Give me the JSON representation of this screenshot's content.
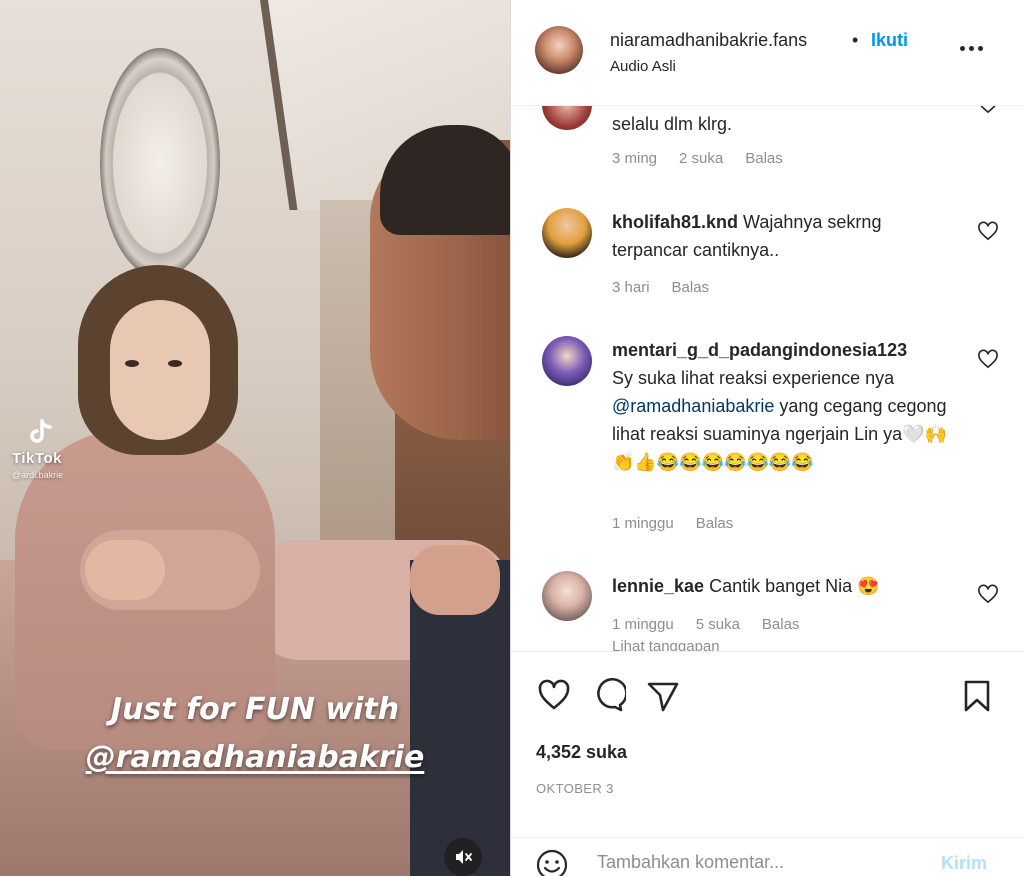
{
  "video": {
    "watermark_brand": "TikTok",
    "watermark_user": "@ardi.bakrie",
    "caption_line1": "Just for FUN with",
    "caption_line2": "@ramadhaniabakrie"
  },
  "header": {
    "username": "niaramadhanibakrie.fans",
    "separator": "•",
    "follow_label": "Ikuti",
    "audio": "Audio Asli"
  },
  "comments": [
    {
      "username": "",
      "text": "selalu dlm klrg.",
      "time": "3 ming",
      "likes": "2 suka",
      "reply": "Balas"
    },
    {
      "username": "kholifah81.knd",
      "text": "Wajahnya sekrng terpancar cantiknya..",
      "time": "3 hari",
      "likes": "",
      "reply": "Balas"
    },
    {
      "username": "mentari_g_d_padangindonesia123",
      "text_before": "Sy suka lihat reaksi experience nya ",
      "mention": "@ramadhaniabakrie",
      "text_after": " yang cegang cegong lihat reaksi suaminya ngerjain Lin ya🤍🙌👏👍😂😂😂😂😂😂😂",
      "time": "1 minggu",
      "likes": "",
      "reply": "Balas"
    },
    {
      "username": "lennie_kae",
      "text": "Cantik banget Nia 😍",
      "time": "1 minggu",
      "likes": "5 suka",
      "reply": "Balas",
      "view_replies": "Lihat tanggapan"
    }
  ],
  "post": {
    "likes": "4,352 suka",
    "date": "OKTOBER 3"
  },
  "add_comment": {
    "placeholder": "Tambahkan komentar...",
    "post_label": "Kirim"
  },
  "colors": {
    "link_blue": "#0095f6",
    "post_disabled": "#b2dffc",
    "muted_text": "#8e8e8e",
    "mention": "#00376b"
  },
  "icons": [
    "tiktok-logo-icon",
    "mute-icon",
    "more-options-icon",
    "heart-icon",
    "comment-icon",
    "share-icon",
    "bookmark-icon",
    "emoji-icon"
  ]
}
